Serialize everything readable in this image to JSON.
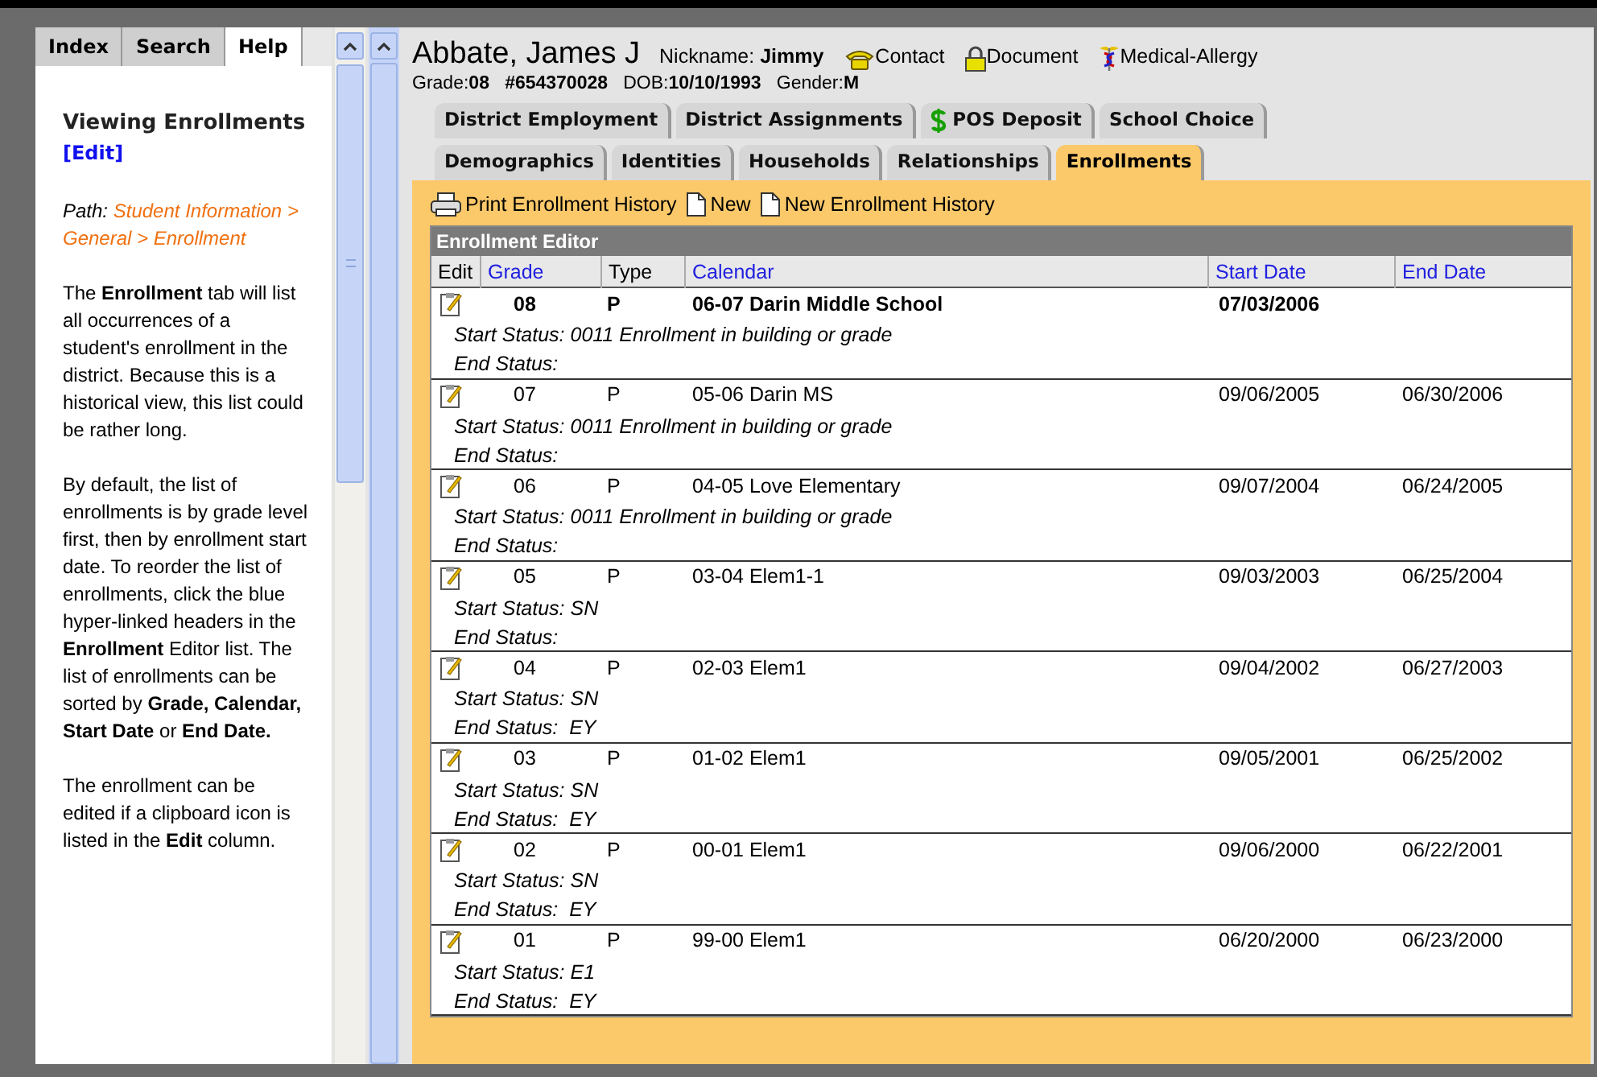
{
  "help_tabs": [
    {
      "label": "Index",
      "selected": false
    },
    {
      "label": "Search",
      "selected": false
    },
    {
      "label": "Help",
      "selected": true
    }
  ],
  "help": {
    "title": "Viewing Enrollments",
    "edit_link": "[Edit]",
    "path_label": "Path:",
    "path": "Student Information > General > Enrollment",
    "paragraphs": [
      "The **Enrollment** tab will list all occurrences of a student's enrollment in the district.  Because this is a historical view, this list could be rather long.",
      "By default, the list of enrollments is by grade level first, then by enrollment start date.  To reorder the list of enrollments, click the blue hyper-linked headers in the **Enrollment** Editor list. The list of enrollments can be sorted by **Grade, Calendar, Start Date** or **End Date.**",
      "The enrollment can be edited if a clipboard icon is listed in the **Edit** column."
    ]
  },
  "student": {
    "name": "Abbate, James J",
    "nickname_label": "Nickname:",
    "nickname": "Jimmy",
    "links": [
      {
        "kind": "phone",
        "label": "Contact"
      },
      {
        "kind": "lock",
        "label": "Document"
      },
      {
        "kind": "medical",
        "label": "Medical-Allergy"
      }
    ],
    "grade_label": "Grade:",
    "grade": "08",
    "id": "#654370028",
    "dob_label": "DOB:",
    "dob": "10/10/1993",
    "gender_label": "Gender:",
    "gender": "M"
  },
  "tab_rows": [
    [
      {
        "label": "District Employment",
        "selected": false
      },
      {
        "label": "District Assignments",
        "selected": false
      },
      {
        "label": "POS Deposit",
        "selected": false,
        "kind": "dollar"
      },
      {
        "label": "School Choice",
        "selected": false
      }
    ],
    [
      {
        "label": "Demographics",
        "selected": false
      },
      {
        "label": "Identities",
        "selected": false
      },
      {
        "label": "Households",
        "selected": false
      },
      {
        "label": "Relationships",
        "selected": false
      },
      {
        "label": "Enrollments",
        "selected": true
      }
    ]
  ],
  "toolbar": [
    {
      "kind": "print",
      "label": "Print Enrollment History"
    },
    {
      "kind": "new",
      "label": "New"
    },
    {
      "kind": "new",
      "label": "New Enrollment History"
    }
  ],
  "editor": {
    "title": "Enrollment Editor",
    "columns": [
      {
        "label": "Edit",
        "link": false
      },
      {
        "label": "Grade",
        "link": true
      },
      {
        "label": "Type",
        "link": false
      },
      {
        "label": "Calendar",
        "link": true
      },
      {
        "label": "Start Date",
        "link": true
      },
      {
        "label": "End Date",
        "link": true
      }
    ],
    "rows": [
      {
        "grade": "08",
        "type": "P",
        "calendar": "06-07 Darin Middle School",
        "start": "07/03/2006",
        "current": true,
        "start_status": "Start Status: 0011 Enrollment in building or grade",
        "end_status": "End Status:"
      },
      {
        "grade": "07",
        "type": "P",
        "calendar": "05-06 Darin MS",
        "start": "09/06/2005",
        "end": "06/30/2006",
        "current": false,
        "start_status": "Start Status: 0011 Enrollment in building or grade",
        "end_status": "End Status:"
      },
      {
        "grade": "06",
        "type": "P",
        "calendar": "04-05 Love Elementary",
        "start": "09/07/2004",
        "end": "06/24/2005",
        "current": false,
        "start_status": "Start Status: 0011 Enrollment in building or grade",
        "end_status": "End Status:"
      },
      {
        "grade": "05",
        "type": "P",
        "calendar": "03-04 Elem1-1",
        "start": "09/03/2003",
        "end": "06/25/2004",
        "current": false,
        "start_status": "Start Status: SN",
        "end_status": "End Status:"
      },
      {
        "grade": "04",
        "type": "P",
        "calendar": "02-03 Elem1",
        "start": "09/04/2002",
        "end": "06/27/2003",
        "current": false,
        "start_status": "Start Status: SN",
        "end_status": "End Status:  EY"
      },
      {
        "grade": "03",
        "type": "P",
        "calendar": "01-02 Elem1",
        "start": "09/05/2001",
        "end": "06/25/2002",
        "current": false,
        "start_status": "Start Status: SN",
        "end_status": "End Status:  EY"
      },
      {
        "grade": "02",
        "type": "P",
        "calendar": "00-01 Elem1",
        "start": "09/06/2000",
        "end": "06/22/2001",
        "current": false,
        "start_status": "Start Status: SN",
        "end_status": "End Status:  EY"
      },
      {
        "grade": "01",
        "type": "P",
        "calendar": "99-00 Elem1",
        "start": "06/20/2000",
        "end": "06/23/2000",
        "current": false,
        "start_status": "Start Status: E1",
        "end_status": "End Status:  EY"
      }
    ]
  }
}
